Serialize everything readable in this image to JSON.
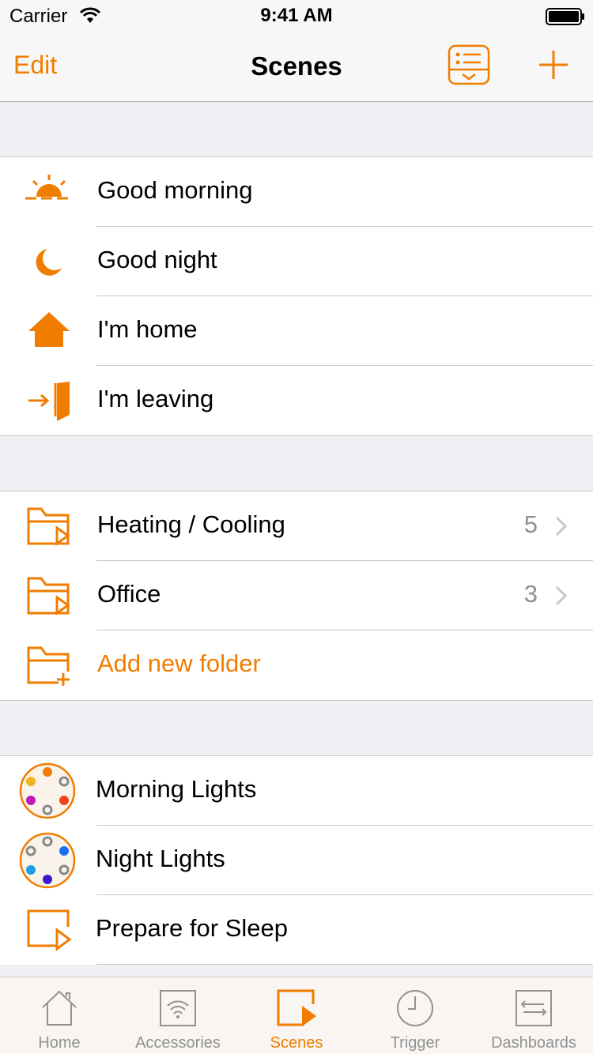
{
  "status_bar": {
    "carrier": "Carrier",
    "time": "9:41 AM"
  },
  "nav": {
    "edit_label": "Edit",
    "title": "Scenes"
  },
  "scenes": [
    {
      "label": "Good morning",
      "icon": "sunrise-icon"
    },
    {
      "label": "Good night",
      "icon": "moon-icon"
    },
    {
      "label": "I'm home",
      "icon": "house-icon"
    },
    {
      "label": "I'm leaving",
      "icon": "door-exit-icon"
    }
  ],
  "folders": [
    {
      "label": "Heating / Cooling",
      "count": "5",
      "icon": "folder-play-icon"
    },
    {
      "label": "Office",
      "count": "3",
      "icon": "folder-play-icon"
    },
    {
      "label": "Add new folder",
      "icon": "folder-add-icon"
    }
  ],
  "other_scenes": [
    {
      "label": "Morning Lights",
      "icon": "light-colors-icon"
    },
    {
      "label": "Night Lights",
      "icon": "light-colors-icon"
    },
    {
      "label": "Prepare for Sleep",
      "icon": "scene-play-icon"
    }
  ],
  "tabs": [
    {
      "label": "Home",
      "icon": "home-icon",
      "active": false
    },
    {
      "label": "Accessories",
      "icon": "accessories-icon",
      "active": false
    },
    {
      "label": "Scenes",
      "icon": "scenes-icon",
      "active": true
    },
    {
      "label": "Trigger",
      "icon": "clock-icon",
      "active": false
    },
    {
      "label": "Dashboards",
      "icon": "dashboards-icon",
      "active": false
    }
  ],
  "colors": {
    "accent": "#f07d00",
    "tab_inactive": "#929292"
  }
}
